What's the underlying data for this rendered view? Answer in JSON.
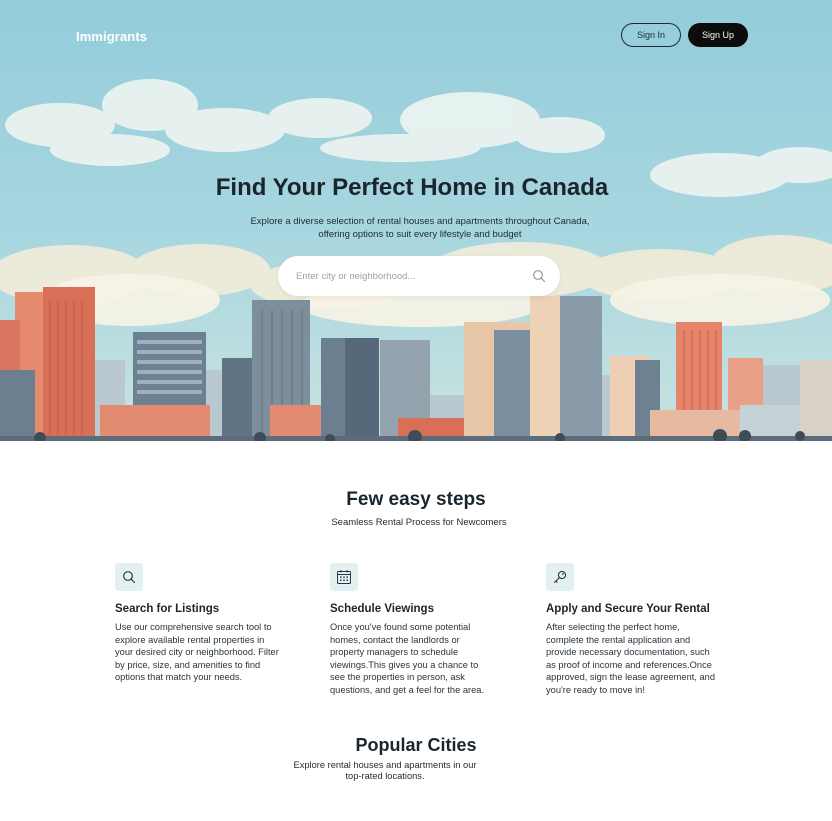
{
  "header": {
    "brand": "Immigrants",
    "sign_in_label": "Sign In",
    "sign_up_label": "Sign Up"
  },
  "hero": {
    "title": "Find Your Perfect Home in Canada",
    "subtitle": "Explore a diverse selection of rental houses and apartments throughout Canada, offering options to suit every lifestyle and budget",
    "search_placeholder": "Enter city or neighborhood...",
    "search_value": ""
  },
  "steps_section": {
    "title": "Few easy steps",
    "subtitle": "Seamless Rental Process for Newcomers",
    "steps": [
      {
        "icon": "search-icon",
        "title": "Search for Listings",
        "text": "Use our comprehensive search tool to explore available rental properties in your desired city or neighborhood. Filter by price, size, and amenities to find options that match your needs."
      },
      {
        "icon": "calendar-icon",
        "title": "Schedule Viewings",
        "text": "Once you've found some potential homes, contact the landlords or property managers to schedule viewings.This gives you a chance to see the properties in person, ask questions, and get a feel for the area."
      },
      {
        "icon": "key-icon",
        "title": "Apply and Secure Your Rental",
        "text": "After selecting the perfect home, complete the rental application and provide necessary documentation, such as proof of income and references.Once approved, sign the lease agreement, and you're ready to move in!"
      }
    ]
  },
  "cities_section": {
    "title": "Popular Cities",
    "subtitle": "Explore rental houses and apartments in our top-rated locations."
  },
  "colors": {
    "sky": "#9acfdc",
    "accent_dark": "#0c0c0c",
    "icon_bg": "#e4f1f3",
    "building_coral": "#e07b62",
    "building_slate": "#5f7384"
  }
}
